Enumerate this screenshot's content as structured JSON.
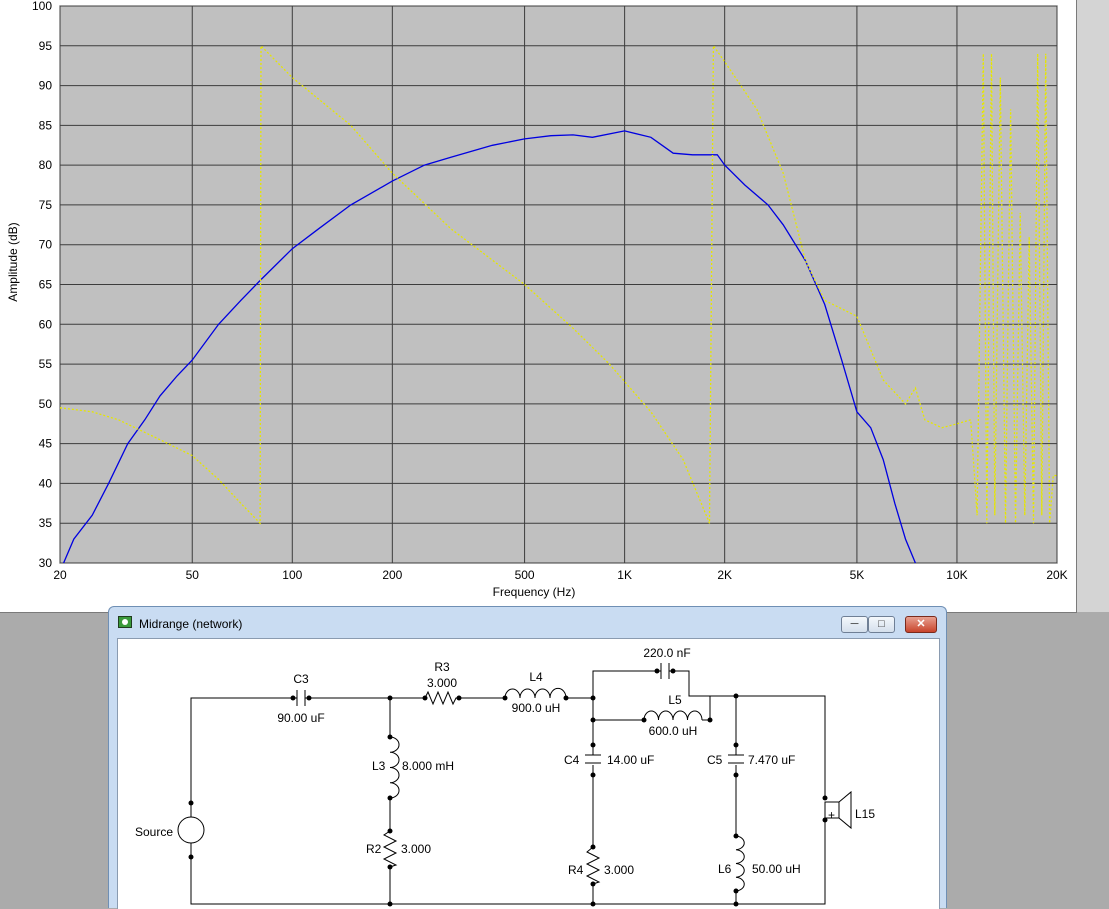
{
  "chart_data": {
    "type": "line",
    "xlabel": "Frequency (Hz)",
    "ylabel": "Amplitude (dB)",
    "x_scale": "log",
    "xlim": [
      20,
      20000
    ],
    "ylim": [
      30,
      100
    ],
    "grid": true,
    "background": "#c0c0c0",
    "x_ticks": [
      20,
      50,
      100,
      200,
      500,
      1000,
      2000,
      5000,
      10000,
      20000
    ],
    "x_tick_labels": [
      "20",
      "50",
      "100",
      "200",
      "500",
      "1K",
      "2K",
      "5K",
      "10K",
      "20K"
    ],
    "y_ticks": [
      30,
      35,
      40,
      45,
      50,
      55,
      60,
      65,
      70,
      75,
      80,
      85,
      90,
      95,
      100
    ],
    "y_tick_labels": [
      "30",
      "35",
      "40",
      "45",
      "50",
      "55",
      "60",
      "65",
      "70",
      "75",
      "80",
      "85",
      "90",
      "95",
      "100"
    ],
    "series": [
      {
        "color": "#0000e0",
        "style": "solid",
        "points": [
          [
            20.5,
            30
          ],
          [
            22,
            33
          ],
          [
            25,
            36
          ],
          [
            28,
            40
          ],
          [
            32,
            45
          ],
          [
            36,
            48
          ],
          [
            40,
            51
          ],
          [
            45,
            53.5
          ],
          [
            50,
            55.5
          ],
          [
            60,
            60
          ],
          [
            70,
            63
          ],
          [
            80,
            65.5
          ],
          [
            100,
            69.5
          ],
          [
            120,
            72
          ],
          [
            150,
            75
          ],
          [
            200,
            78
          ],
          [
            250,
            80
          ],
          [
            300,
            81
          ],
          [
            400,
            82.5
          ],
          [
            500,
            83.3
          ],
          [
            600,
            83.7
          ],
          [
            700,
            83.8
          ],
          [
            800,
            83.5
          ],
          [
            1000,
            84.3
          ],
          [
            1200,
            83.5
          ],
          [
            1400,
            81.5
          ],
          [
            1600,
            81.3
          ],
          [
            1900,
            81.3
          ],
          [
            2000,
            80
          ],
          [
            2300,
            77.5
          ],
          [
            2700,
            75
          ],
          [
            3000,
            72.5
          ],
          [
            3500,
            68
          ],
          [
            4000,
            62.5
          ],
          [
            4500,
            55.5
          ],
          [
            5000,
            49
          ],
          [
            5500,
            47
          ],
          [
            6000,
            43
          ],
          [
            6500,
            37.5
          ],
          [
            7000,
            33
          ],
          [
            7500,
            30
          ]
        ]
      },
      {
        "color": "#e6e600",
        "style": "dotted",
        "points": [
          [
            20,
            49.5
          ],
          [
            25,
            49
          ],
          [
            30,
            48
          ],
          [
            40,
            45.5
          ],
          [
            50,
            43.5
          ],
          [
            60,
            40.5
          ],
          [
            70,
            37.5
          ],
          [
            80,
            35
          ],
          [
            80.5,
            95
          ],
          [
            100,
            91
          ],
          [
            150,
            85
          ],
          [
            200,
            79
          ],
          [
            300,
            72
          ],
          [
            500,
            65
          ],
          [
            700,
            59.5
          ],
          [
            900,
            55
          ],
          [
            1200,
            49
          ],
          [
            1500,
            43
          ],
          [
            1800,
            35
          ],
          [
            1850,
            95
          ],
          [
            2000,
            93
          ],
          [
            2500,
            87
          ],
          [
            3000,
            79
          ],
          [
            3500,
            68
          ],
          [
            4000,
            63
          ],
          [
            5000,
            61
          ],
          [
            6000,
            53
          ],
          [
            7000,
            50
          ],
          [
            7500,
            52
          ],
          [
            8000,
            48
          ],
          [
            9000,
            47
          ],
          [
            10000,
            47.5
          ],
          [
            11000,
            48
          ],
          [
            11500,
            36
          ],
          [
            12000,
            94
          ],
          [
            12300,
            35
          ],
          [
            12700,
            94
          ],
          [
            13000,
            36
          ],
          [
            13500,
            91
          ],
          [
            14000,
            35
          ],
          [
            14500,
            87
          ],
          [
            15000,
            35
          ],
          [
            15500,
            74
          ],
          [
            16000,
            36
          ],
          [
            16500,
            71
          ],
          [
            17000,
            35
          ],
          [
            17500,
            94
          ],
          [
            18000,
            36
          ],
          [
            18500,
            94
          ],
          [
            19000,
            35
          ],
          [
            19500,
            41
          ],
          [
            20000,
            41
          ]
        ]
      }
    ]
  },
  "network_window": {
    "title": "Midrange (network)",
    "components": {
      "c3": {
        "name": "C3",
        "value": "90.00 uF"
      },
      "r3": {
        "name": "R3",
        "value": "3.000"
      },
      "l4": {
        "name": "L4",
        "value": "900.0 uH"
      },
      "c_top": {
        "value": "220.0 nF"
      },
      "l5": {
        "name": "L5",
        "value": "600.0 uH"
      },
      "l3": {
        "name": "L3",
        "value": "8.000 mH"
      },
      "r2": {
        "name": "R2",
        "value": "3.000"
      },
      "c4": {
        "name": "C4",
        "value": "14.00 uF"
      },
      "r4": {
        "name": "R4",
        "value": "3.000"
      },
      "c5": {
        "name": "C5",
        "value": "7.470 uF"
      },
      "l6": {
        "name": "L6",
        "value": "50.00 uH"
      },
      "l15": {
        "name": "L15"
      },
      "source": {
        "name": "Source"
      }
    }
  }
}
